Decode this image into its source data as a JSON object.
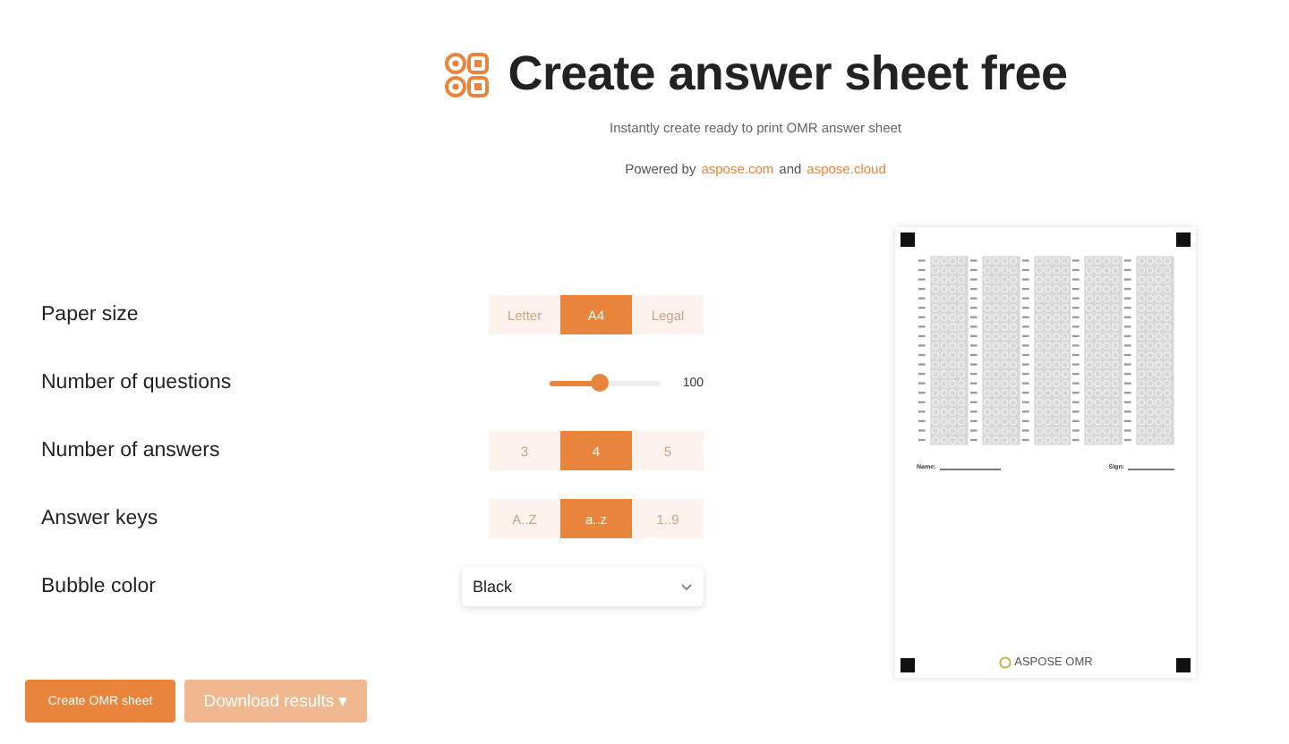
{
  "header": {
    "title": "Create answer sheet free",
    "subtitle": "Instantly create ready to print OMR answer sheet",
    "powered_prefix": "Powered by",
    "link_1": "aspose.com",
    "joiner": "and",
    "link_2": "aspose.cloud"
  },
  "settings": [
    {
      "kind": "segmented",
      "label": "Paper size",
      "options": [
        {
          "label": "Letter",
          "selected": false
        },
        {
          "label": "A4",
          "selected": true
        },
        {
          "label": "Legal",
          "selected": false
        }
      ]
    },
    {
      "kind": "slider",
      "label": "Number of questions",
      "level": 0.45,
      "reading": "100"
    },
    {
      "kind": "segmented",
      "label": "Number of answers",
      "options": [
        {
          "label": "3",
          "selected": false
        },
        {
          "label": "4",
          "selected": true
        },
        {
          "label": "5",
          "selected": false
        }
      ]
    },
    {
      "kind": "segmented",
      "label": "Answer keys",
      "options": [
        {
          "label": "A..Z",
          "selected": false
        },
        {
          "label": "a..z",
          "selected": true
        },
        {
          "label": "1..9",
          "selected": false
        }
      ]
    },
    {
      "kind": "dropdown",
      "label": "Bubble color",
      "value": "Black"
    }
  ],
  "buttons": [
    {
      "label": "Create OMR sheet",
      "kind": "primary"
    },
    {
      "label": "Download results ▾",
      "kind": "secondary"
    }
  ],
  "preview": {
    "name_label": "Name:",
    "sign_label": "Sign:",
    "brand": "ASPOSE OMR"
  }
}
